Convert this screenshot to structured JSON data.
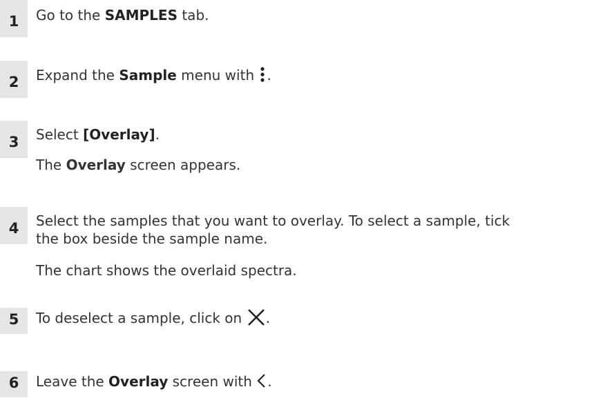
{
  "steps": [
    {
      "number": "1",
      "pre": "Go to the ",
      "bold": "SAMPLES",
      "post": " tab."
    },
    {
      "number": "2",
      "pre": "Expand the ",
      "bold": "Sample",
      "post": " menu with ",
      "icon": "more-vertical-icon",
      "post2": "."
    },
    {
      "number": "3",
      "pre": "Select ",
      "bold": "[Overlay]",
      "post": ".",
      "result_pre": "The ",
      "result_bold": "Overlay",
      "result_post": " screen appears."
    },
    {
      "number": "4",
      "line1": "Select the samples that you want to overlay. To select a sample, tick",
      "line2": "the box beside the sample name.",
      "result": "The chart shows the overlaid spectra."
    },
    {
      "number": "5",
      "pre": "To deselect a sample, click on ",
      "icon": "close-x-icon",
      "post": "."
    },
    {
      "number": "6",
      "pre": "Leave the ",
      "bold": "Overlay",
      "post": " screen with ",
      "icon": "chevron-left-icon",
      "post2": "."
    }
  ]
}
